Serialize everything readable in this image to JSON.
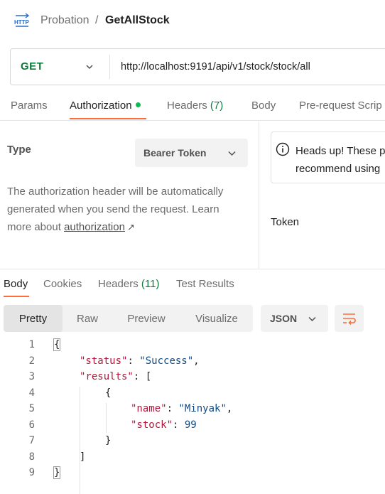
{
  "header": {
    "icon": "http-request-icon",
    "collection": "Probation",
    "separator": "/",
    "request_name": "GetAllStock"
  },
  "url_bar": {
    "method": "GET",
    "url": "http://localhost:9191/api/v1/stock/stock/all"
  },
  "request_tabs": [
    {
      "label": "Params",
      "count": "",
      "active": false
    },
    {
      "label": "Authorization",
      "count": "",
      "active": true
    },
    {
      "label": "Headers",
      "count": "(7)",
      "active": false
    },
    {
      "label": "Body",
      "count": "",
      "active": false
    },
    {
      "label": "Pre-request Scrip",
      "count": "",
      "active": false
    }
  ],
  "authorization": {
    "type_label": "Type",
    "type_value": "Bearer Token",
    "desc_line1": "The authorization header will be automatically",
    "desc_line2": "generated when you send the request. Learn",
    "desc_line3_pre": "more about",
    "desc_link": "authorization",
    "info_line1": "Heads up! These p",
    "info_line2": "recommend using",
    "token_label": "Token"
  },
  "response_tabs": [
    {
      "label": "Body",
      "count": "",
      "active": true
    },
    {
      "label": "Cookies",
      "count": "",
      "active": false
    },
    {
      "label": "Headers",
      "count": "(11)",
      "active": false
    },
    {
      "label": "Test Results",
      "count": "",
      "active": false
    }
  ],
  "view_modes": [
    "Pretty",
    "Raw",
    "Preview",
    "Visualize"
  ],
  "active_view": "Pretty",
  "format": "JSON",
  "colors": {
    "accent": "#ff6c37",
    "method_get": "#0c7b3c",
    "auth_dot": "#0cbb52",
    "json_key": "#b2183d",
    "json_value": "#0f4a85"
  },
  "response_body": {
    "line_numbers": [
      "1",
      "2",
      "3",
      "4",
      "5",
      "6",
      "7",
      "8",
      "9"
    ],
    "open_brace": "{",
    "status_key": "\"status\"",
    "status_value": "\"Success\"",
    "results_key": "\"results\"",
    "array_open": "[",
    "item_open": "{",
    "name_key": "\"name\"",
    "name_value": "\"Minyak\"",
    "stock_key": "\"stock\"",
    "stock_value": "99",
    "item_close": "}",
    "array_close": "]",
    "close_brace": "}"
  }
}
